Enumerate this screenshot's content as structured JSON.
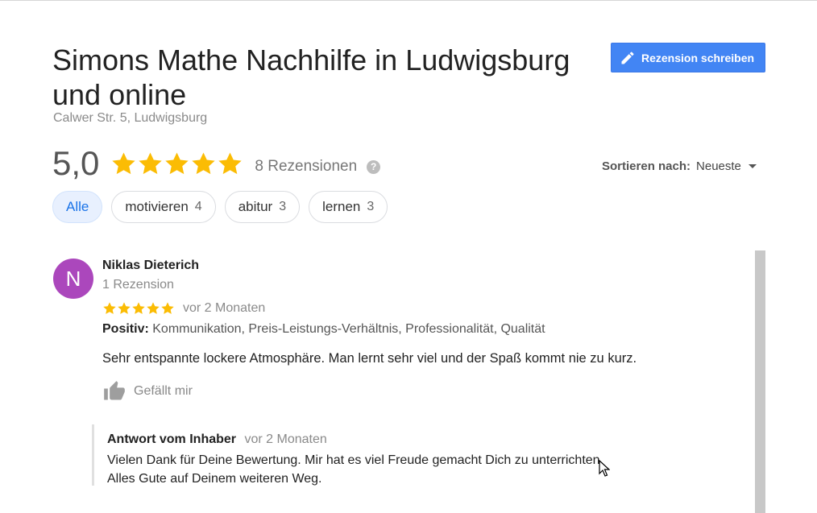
{
  "business": {
    "title": "Simons Mathe Nachhilfe in Ludwigsburg und online",
    "address": "Calwer Str. 5, Ludwigsburg"
  },
  "actions": {
    "write_review_label": "Rezension schreiben",
    "write_icon": "pencil-icon"
  },
  "summary": {
    "score": "5,0",
    "stars": 5,
    "review_count_label": "8 Rezensionen",
    "help_icon_label": "?"
  },
  "sort": {
    "label": "Sortieren nach:",
    "value": "Neueste"
  },
  "filters": [
    {
      "label": "Alle",
      "count": "",
      "active": true
    },
    {
      "label": "motivieren",
      "count": "4",
      "active": false
    },
    {
      "label": "abitur",
      "count": "3",
      "active": false
    },
    {
      "label": "lernen",
      "count": "3",
      "active": false
    }
  ],
  "review": {
    "avatar_initial": "N",
    "avatar_color": "#ab47bc",
    "name": "Niklas Dieterich",
    "reviewer_count": "1 Rezension",
    "stars": 5,
    "time": "vor 2 Monaten",
    "positive_label": "Positiv:",
    "positive_text": "Kommunikation, Preis-Leistungs-Verhältnis, Professionalität, Qualität",
    "text": "Sehr entspannte lockere Atmosphäre. Man lernt sehr viel und der Spaß kommt nie zu kurz.",
    "like_label": "Gefällt mir",
    "owner_reply": {
      "title": "Antwort vom Inhaber",
      "time": "vor 2 Monaten",
      "line1": "Vielen Dank für Deine Bewertung. Mir hat es viel Freude gemacht Dich zu unterrichten.",
      "line2": "Alles Gute auf Deinem weiteren Weg."
    }
  },
  "colors": {
    "accent": "#4285f4",
    "star": "#fbbc04",
    "chip_active_bg": "#e8f0fe",
    "chip_active_text": "#1a73e8"
  }
}
